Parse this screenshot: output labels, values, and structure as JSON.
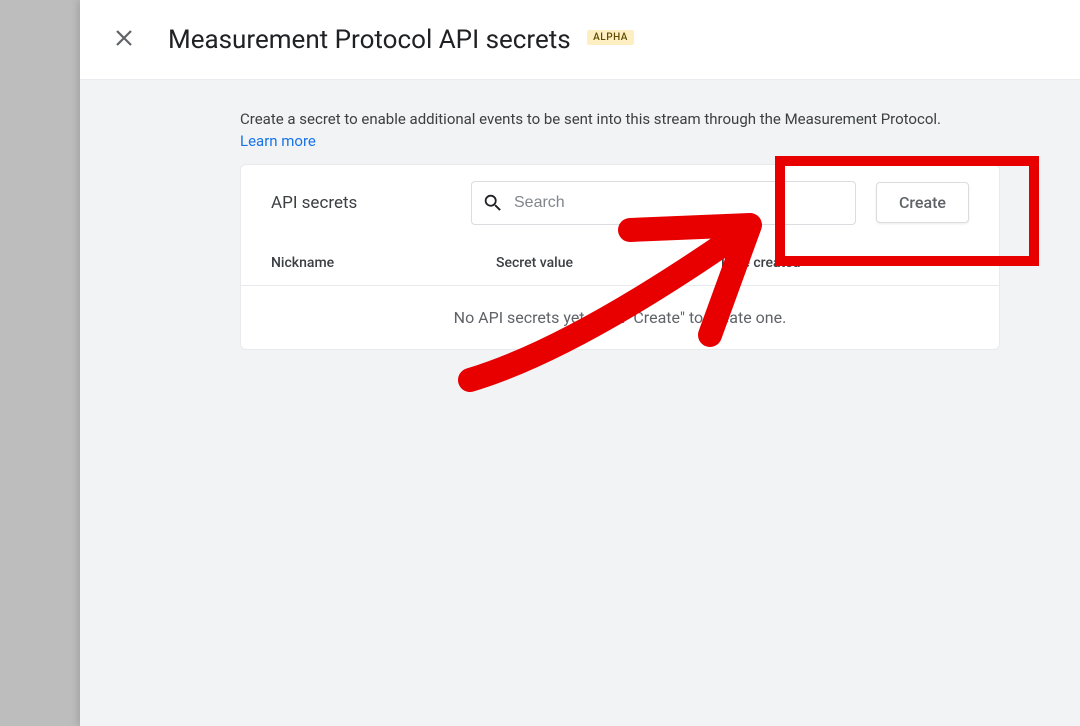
{
  "header": {
    "title": "Measurement Protocol API secrets",
    "badge": "ALPHA"
  },
  "intro": {
    "text": "Create a secret to enable additional events to be sent into this stream through the Measurement Protocol.",
    "learn_more": "Learn more"
  },
  "card": {
    "section_title": "API secrets",
    "search_placeholder": "Search",
    "create_label": "Create",
    "columns": {
      "nickname": "Nickname",
      "secret": "Secret value",
      "date": "Date created"
    },
    "empty_message": "No API secrets yet, click \"Create\" to create one."
  }
}
